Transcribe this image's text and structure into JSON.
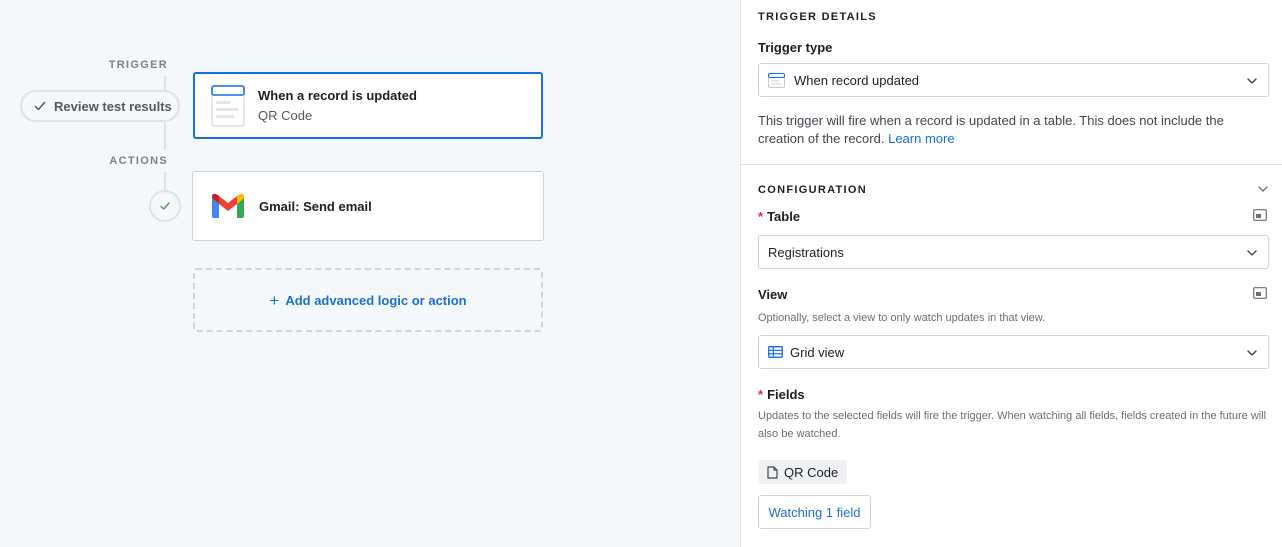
{
  "canvas": {
    "trigger_label": "TRIGGER",
    "actions_label": "ACTIONS",
    "review_button": "Review test results",
    "trigger_card": {
      "title": "When a record is updated",
      "subtitle": "QR Code"
    },
    "action_card": {
      "title": "Gmail: Send email"
    },
    "add_action": "Add advanced logic or action"
  },
  "panel": {
    "trigger_details": {
      "heading": "TRIGGER DETAILS",
      "trigger_type_label": "Trigger type",
      "trigger_type_value": "When record updated",
      "description": "This trigger will fire when a record is updated in a table. This does not include the creation of the record.",
      "learn_more": "Learn more"
    },
    "configuration": {
      "heading": "CONFIGURATION",
      "table_label": "Table",
      "table_value": "Registrations",
      "view_label": "View",
      "view_help": "Optionally, select a view to only watch updates in that view.",
      "view_value": "Grid view",
      "fields_label": "Fields",
      "fields_help": "Updates to the selected fields will fire the trigger. When watching all fields, fields created in the future will also be watched.",
      "field_chip": "QR Code",
      "watching_button": "Watching 1 field"
    }
  },
  "colors": {
    "accent": "#176ee1",
    "link": "#1b6fd1",
    "required": "#dc2c3e",
    "canvas_bg": "#f5f8fb"
  }
}
